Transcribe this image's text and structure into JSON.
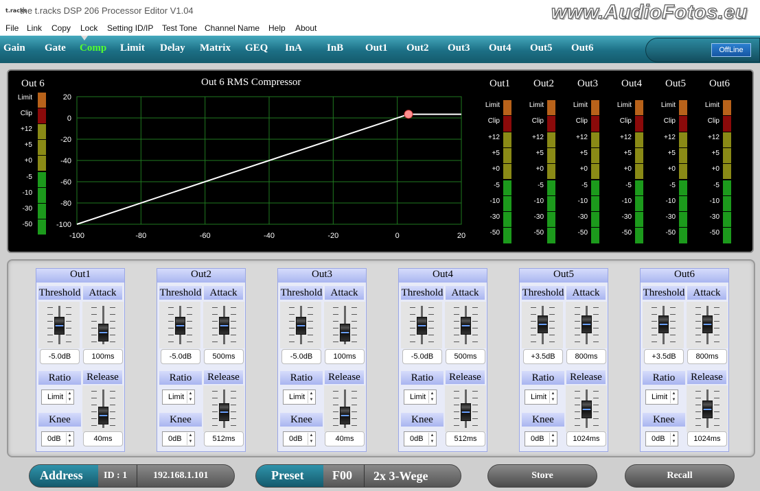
{
  "window": {
    "title": "the t.racks DSP 206 Processor Editor V1.04",
    "icon_text": "t.racks",
    "watermark": "www.AudioFotos.eu"
  },
  "menu": [
    "File",
    "Link",
    "Copy",
    "Lock",
    "Setting ID/IP",
    "Test Tone",
    "Channel Name",
    "Help",
    "About"
  ],
  "tabs": [
    "Gain",
    "Gate",
    "Comp",
    "Limit",
    "Delay",
    "Matrix",
    "GEQ",
    "InA",
    "InB",
    "Out1",
    "Out2",
    "Out3",
    "Out4",
    "Out5",
    "Out6"
  ],
  "active_tab": "Comp",
  "status": "OffLine",
  "graph": {
    "channel_label": "Out 6",
    "title": "Out 6  RMS Compressor",
    "x_ticks": [
      "-100",
      "-80",
      "-60",
      "-40",
      "-20",
      "0",
      "20"
    ],
    "y_ticks": [
      "20",
      "0",
      "-20",
      "-40",
      "-60",
      "-80",
      "-100"
    ],
    "threshold_db": 3.5
  },
  "meter_labels": [
    "Limit",
    "Clip",
    "+12",
    "+5",
    "+0",
    "-5",
    "-10",
    "-30",
    "-50"
  ],
  "meters": [
    "Out1",
    "Out2",
    "Out3",
    "Out4",
    "Out5",
    "Out6"
  ],
  "colors": {
    "limit": "#b8621a",
    "clip": "#8b0a0a",
    "yellow": "#8a8a16",
    "green": "#1c9a1c",
    "accent": "#53ff2e"
  },
  "channels": [
    {
      "name": "Out1",
      "threshold": "-5.0dB",
      "attack": "100ms",
      "ratio": "Limit",
      "release": "40ms",
      "knee": "0dB",
      "threshold_level": 0.55,
      "attack_level": 0.28,
      "release_level": 0.3
    },
    {
      "name": "Out2",
      "threshold": "-5.0dB",
      "attack": "500ms",
      "ratio": "Limit",
      "release": "512ms",
      "knee": "0dB",
      "threshold_level": 0.55,
      "attack_level": 0.55,
      "release_level": 0.45
    },
    {
      "name": "Out3",
      "threshold": "-5.0dB",
      "attack": "100ms",
      "ratio": "Limit",
      "release": "40ms",
      "knee": "0dB",
      "threshold_level": 0.55,
      "attack_level": 0.28,
      "release_level": 0.3
    },
    {
      "name": "Out4",
      "threshold": "-5.0dB",
      "attack": "500ms",
      "ratio": "Limit",
      "release": "512ms",
      "knee": "0dB",
      "threshold_level": 0.55,
      "attack_level": 0.55,
      "release_level": 0.45
    },
    {
      "name": "Out5",
      "threshold": "+3.5dB",
      "attack": "800ms",
      "ratio": "Limit",
      "release": "1024ms",
      "knee": "0dB",
      "threshold_level": 0.62,
      "attack_level": 0.62,
      "release_level": 0.55
    },
    {
      "name": "Out6",
      "threshold": "+3.5dB",
      "attack": "800ms",
      "ratio": "Limit",
      "release": "1024ms",
      "knee": "0dB",
      "threshold_level": 0.62,
      "attack_level": 0.62,
      "release_level": 0.55
    }
  ],
  "labels": {
    "threshold": "Threshold",
    "attack": "Attack",
    "ratio": "Ratio",
    "release": "Release",
    "knee": "Knee"
  },
  "bottom": {
    "address_label": "Address",
    "id": "ID : 1",
    "ip": "192.168.1.101",
    "preset_label": "Preset",
    "preset_code": "F00",
    "preset_name": "2x 3-Wege",
    "store": "Store",
    "recall": "Recall"
  }
}
